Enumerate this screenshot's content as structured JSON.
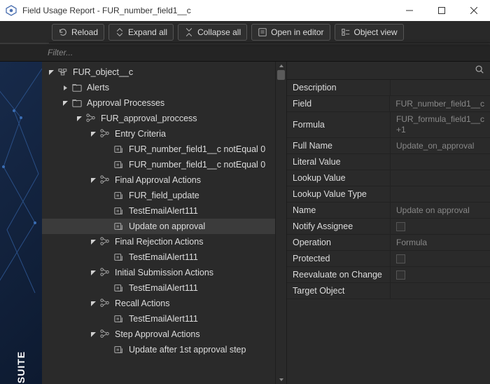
{
  "window": {
    "title": "Field Usage Report - FUR_number_field1__c"
  },
  "toolbar": {
    "reload": "Reload",
    "expand": "Expand all",
    "collapse": "Collapse all",
    "open": "Open in editor",
    "objview": "Object view"
  },
  "filter": {
    "placeholder": "Filter..."
  },
  "sidebar": {
    "suite": "SUITE"
  },
  "tree": {
    "root": "FUR_object__c",
    "alerts": "Alerts",
    "approval": "Approval Processes",
    "approval_proc": "FUR_approval_proccess",
    "entry_criteria": "Entry Criteria",
    "entry_item1": "FUR_number_field1__c notEqual 0",
    "entry_item2": "FUR_number_field1__c notEqual 0",
    "final_approval": "Final Approval Actions",
    "fa1": "FUR_field_update",
    "fa2": "TestEmailAlert111",
    "fa3": "Update on approval",
    "final_rejection": "Final Rejection Actions",
    "fr1": "TestEmailAlert111",
    "initial_submission": "Initial Submission Actions",
    "is1": "TestEmailAlert111",
    "recall": "Recall Actions",
    "rc1": "TestEmailAlert111",
    "step_approval": "Step Approval Actions",
    "sa1": "Update after 1st approval step"
  },
  "properties": {
    "rows": [
      {
        "name": "Description",
        "value": ""
      },
      {
        "name": "Field",
        "value": "FUR_number_field1__c"
      },
      {
        "name": "Formula",
        "value": "FUR_formula_field1__c +1"
      },
      {
        "name": "Full Name",
        "value": "Update_on_approval"
      },
      {
        "name": "Literal Value",
        "value": ""
      },
      {
        "name": "Lookup Value",
        "value": ""
      },
      {
        "name": "Lookup Value Type",
        "value": ""
      },
      {
        "name": "Name",
        "value": "Update on approval"
      },
      {
        "name": "Notify Assignee",
        "value": "[check]"
      },
      {
        "name": "Operation",
        "value": "Formula"
      },
      {
        "name": "Protected",
        "value": "[check]"
      },
      {
        "name": "Reevaluate on Change",
        "value": "[check]"
      },
      {
        "name": "Target Object",
        "value": ""
      }
    ]
  }
}
